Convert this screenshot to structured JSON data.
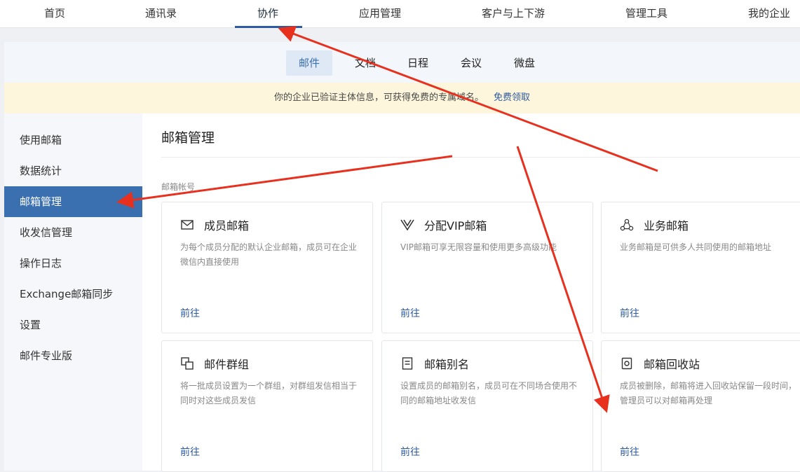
{
  "topnav": {
    "items": [
      "首页",
      "通讯录",
      "协作",
      "应用管理",
      "客户与上下游",
      "管理工具",
      "我的企业"
    ],
    "active_index": 2
  },
  "subnav": {
    "items": [
      "邮件",
      "文档",
      "日程",
      "会议",
      "微盘"
    ],
    "active_index": 0
  },
  "notice": {
    "text": "你的企业已验证主体信息，可获得免费的专属域名。",
    "link": "免费领取"
  },
  "sidebar": {
    "items": [
      "使用邮箱",
      "数据统计",
      "邮箱管理",
      "收发信管理",
      "操作日志",
      "Exchange邮箱同步",
      "设置",
      "邮件专业版"
    ],
    "active_index": 2
  },
  "main": {
    "title": "邮箱管理",
    "section_label": "邮箱帐号",
    "cards": [
      {
        "icon": "envelope-icon",
        "title": "成员邮箱",
        "desc": "为每个成员分配的默认企业邮箱，成员可在企业微信内直接使用",
        "link": "前往"
      },
      {
        "icon": "vip-icon",
        "title": "分配VIP邮箱",
        "desc": "VIP邮箱可享无限容量和使用更多高级功能",
        "link": "前往"
      },
      {
        "icon": "business-icon",
        "title": "业务邮箱",
        "desc": "业务邮箱是可供多人共同使用的邮箱地址",
        "link": "前往"
      },
      {
        "icon": "group-icon",
        "title": "邮件群组",
        "desc": "将一批成员设置为一个群组，对群组发信相当于同时对这些成员发信",
        "link": "前往"
      },
      {
        "icon": "alias-icon",
        "title": "邮箱别名",
        "desc": "设置成员的邮箱别名，成员可在不同场合使用不同的邮箱地址收发信",
        "link": "前往"
      },
      {
        "icon": "recycle-icon",
        "title": "邮箱回收站",
        "desc": "成员被删除，邮箱将进入回收站保留一段时间，管理员可以对邮箱再处理",
        "link": "前往"
      }
    ]
  },
  "colors": {
    "accent": "#3a6fb0",
    "link": "#2d5aa0",
    "notice_bg": "#fdf6dc",
    "annotation_arrow": "#e8301e"
  }
}
